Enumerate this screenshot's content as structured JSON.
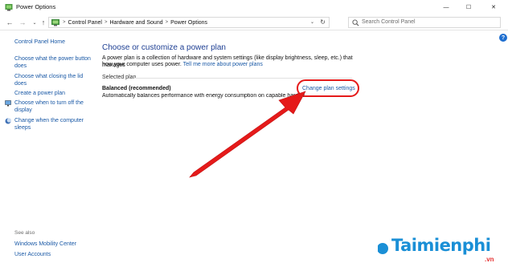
{
  "window": {
    "title": "Power Options",
    "controls": {
      "minimize": "—",
      "maximize": "☐",
      "close": "✕"
    }
  },
  "address": {
    "breadcrumbs": [
      "Control Panel",
      "Hardware and Sound",
      "Power Options"
    ],
    "search_placeholder": "Search Control Panel"
  },
  "sidebar": {
    "home": "Control Panel Home",
    "items": [
      {
        "label_line1": "Choose what the power button",
        "label_line2": "does",
        "icon": ""
      },
      {
        "label_line1": "Choose what closing the lid",
        "label_line2": "does",
        "icon": ""
      },
      {
        "label_line1": "Create a power plan",
        "label_line2": "",
        "icon": ""
      },
      {
        "label_line1": "Choose when to turn off the",
        "label_line2": "display",
        "icon": "monitor-icon"
      },
      {
        "label_line1": "Change when the computer",
        "label_line2": "sleeps",
        "icon": "moon-icon"
      }
    ],
    "see_also": {
      "heading": "See also",
      "links": [
        "Windows Mobility Center",
        "User Accounts"
      ]
    }
  },
  "main": {
    "title": "Choose or customize a power plan",
    "description_line1": "A power plan is a collection of hardware and system settings (like display brightness, sleep, etc.) that manages",
    "description_line2_prefix": "how your computer uses power.",
    "description_link": "Tell me more about power plans",
    "section_label": "Selected plan",
    "plan": {
      "name": "Balanced (recommended)",
      "description": "Automatically balances performance with energy consumption on capable hardware.",
      "change_link": "Change plan settings"
    }
  },
  "watermark": {
    "brand": "Taimienphi",
    "suffix": ".vn"
  },
  "colors": {
    "link": "#1a59a6",
    "title": "#1e3f93",
    "highlight": "#e51a1a"
  }
}
